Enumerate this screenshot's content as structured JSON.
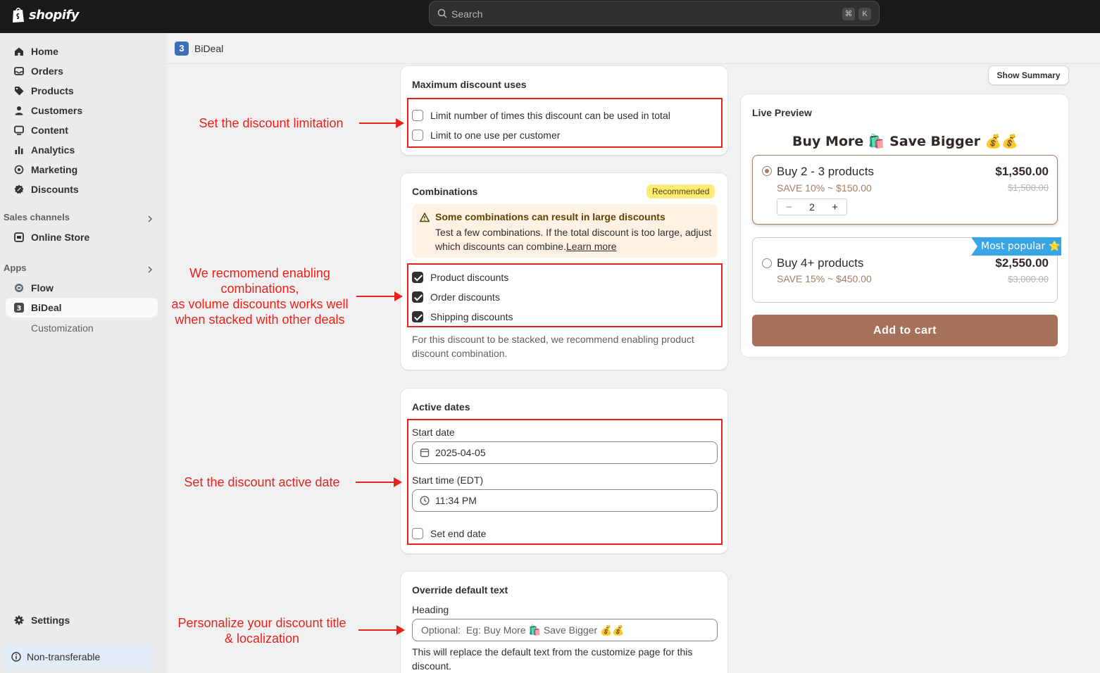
{
  "topbar": {
    "brand": "shopify",
    "search_placeholder": "Search",
    "shortcut_key1": "⌘",
    "shortcut_key2": "K"
  },
  "sidebar": {
    "items": [
      {
        "label": "Home",
        "icon": "home-icon"
      },
      {
        "label": "Orders",
        "icon": "inbox-icon"
      },
      {
        "label": "Products",
        "icon": "tag-icon"
      },
      {
        "label": "Customers",
        "icon": "person-icon"
      },
      {
        "label": "Content",
        "icon": "monitor-icon"
      },
      {
        "label": "Analytics",
        "icon": "bar-chart-icon"
      },
      {
        "label": "Marketing",
        "icon": "target-icon"
      },
      {
        "label": "Discounts",
        "icon": "discount-icon"
      }
    ],
    "sales_channels_label": "Sales channels",
    "online_store_label": "Online Store",
    "apps_label": "Apps",
    "flow_label": "Flow",
    "bideal_label": "BiDeal",
    "customization_label": "Customization",
    "settings_label": "Settings",
    "non_transferable_label": "Non-transferable"
  },
  "appbar": {
    "app_logo_letter": "3",
    "app_name": "BiDeal"
  },
  "max_uses": {
    "title": "Maximum discount uses",
    "limit_total_label": "Limit number of times this discount can be used in total",
    "limit_customer_label": "Limit to one use per customer"
  },
  "combinations": {
    "title": "Combinations",
    "badge": "Recommended",
    "warning_title": "Some combinations can result in large discounts",
    "warning_body": "Test a few combinations. If the total discount is too large, adjust which discounts can combine.",
    "learn_more": "Learn more",
    "product_label": "Product discounts",
    "order_label": "Order discounts",
    "shipping_label": "Shipping discounts",
    "help": "For this discount to be stacked, we recommend enabling product discount combination."
  },
  "active_dates": {
    "title": "Active dates",
    "start_date_label": "Start date",
    "start_date_value": "2025-04-05",
    "start_time_label": "Start time (EDT)",
    "start_time_value": "11:34 PM",
    "set_end_label": "Set end date"
  },
  "override": {
    "title": "Override default text",
    "heading_label": "Heading",
    "heading_placeholder": "Optional:  Eg: Buy More 🛍️ Save Bigger 💰💰",
    "help": "This will replace the default text from the customize page for this discount."
  },
  "annotations": {
    "limitation": "Set the discount limitation",
    "combo_1": "We recmomend enabling",
    "combo_2": "combinations,",
    "combo_3": "as volume discounts works well",
    "combo_4": "when stacked with other deals",
    "dates": "Set the discount active date",
    "personalize_1": "Personalize your discount title",
    "personalize_2": "& localization"
  },
  "preview": {
    "show_summary": "Show Summary",
    "label": "Live Preview",
    "title": "Buy More 🛍️ Save Bigger 💰💰",
    "tier1_name": "Buy 2 - 3 products",
    "tier1_save": "SAVE 10% ~ $150.00",
    "tier1_price": "$1,350.00",
    "tier1_orig": "$1,500.00",
    "tier1_qty": "2",
    "tier2_name": "Buy 4+ products",
    "tier2_save": "SAVE 15% ~ $450.00",
    "tier2_price": "$2,550.00",
    "tier2_orig": "$3,000.00",
    "popular_badge": "Most popular ⭐",
    "add_to_cart": "Add to cart"
  },
  "colors": {
    "annotation_red": "#e8221b",
    "brand_brown": "#a6705a",
    "popular_blue": "#3aa5e6"
  }
}
